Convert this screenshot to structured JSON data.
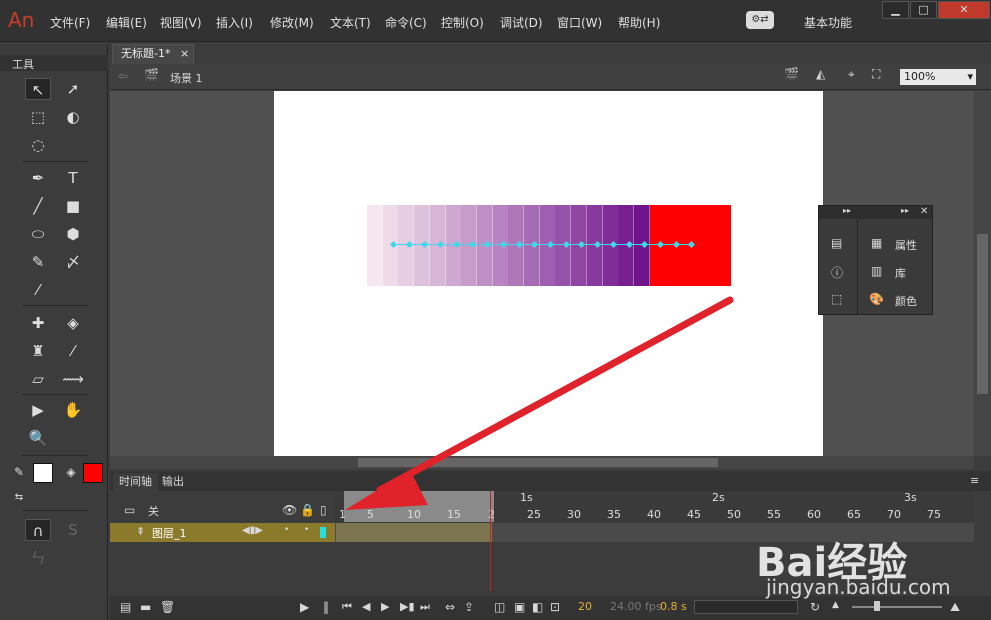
{
  "app": {
    "logo": "An",
    "sync_icon": "sync-settings-icon",
    "workspace": "基本功能",
    "min": "▁",
    "max": "□",
    "close": "✕"
  },
  "menu": [
    "文件(F)",
    "编辑(E)",
    "视图(V)",
    "插入(I)",
    "修改(M)",
    "文本(T)",
    "命令(C)",
    "控制(O)",
    "调试(D)",
    "窗口(W)",
    "帮助(H)"
  ],
  "tools": {
    "header": "工具",
    "stroke_color": "#ffffff",
    "fill_color": "#ff0000"
  },
  "document": {
    "tab": "无标题-1*",
    "tab_close": "×",
    "scene": "场景 1",
    "zoom": "100%"
  },
  "stage": {
    "square_color": "#fe0000"
  },
  "panel": {
    "items": [
      "属性",
      "库",
      "颜色"
    ]
  },
  "timeline": {
    "tab_timeline": "时间轴",
    "tab_output": "输出",
    "header_label": "关",
    "layer_name": "图层_1",
    "frame_numbers": [
      "1",
      "5",
      "10",
      "15",
      "2",
      "25",
      "30",
      "35",
      "40",
      "45",
      "50",
      "55",
      "60",
      "65",
      "70",
      "75"
    ],
    "seconds": [
      "1s",
      "2s",
      "3s"
    ],
    "fps_frame": "20",
    "fps": "24.00 fps",
    "time": "0.8 s"
  },
  "watermark": {
    "brand": "Bai经验",
    "url": "jingyan.baidu.com"
  }
}
